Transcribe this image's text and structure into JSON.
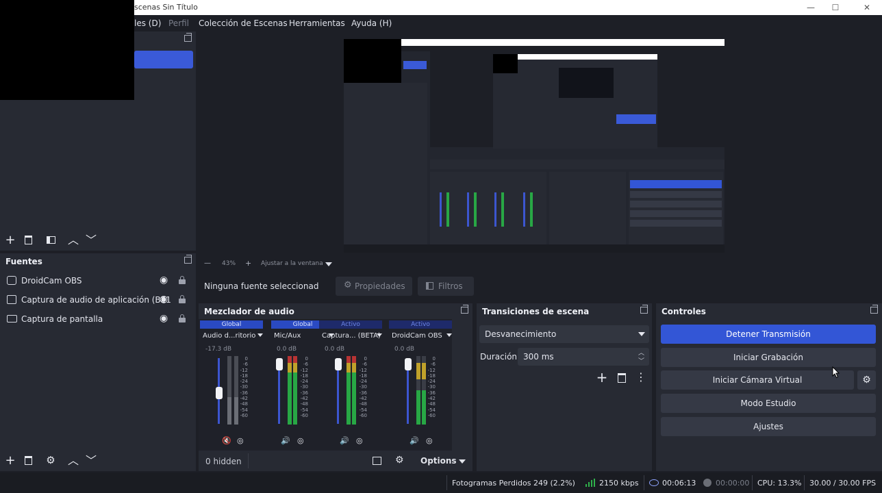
{
  "window": {
    "title": "scenas Sin Título",
    "controls": {
      "minimize": "—",
      "maximize": "☐",
      "close": "✕"
    }
  },
  "menu": {
    "items": [
      "les (D)",
      "Perfil",
      "Colección de Escenas",
      "Herramientas",
      "Ayuda (H)"
    ]
  },
  "scenes_dock": {
    "toolbar_icons": [
      "plus-icon",
      "trash-icon",
      "filter-icon",
      "arrow-up-icon",
      "arrow-down-icon"
    ]
  },
  "sources_dock": {
    "title": "Fuentes",
    "items": [
      {
        "name": "DroidCam OBS",
        "icon": "camera-icon"
      },
      {
        "name": "Captura de audio de aplicación (BE1",
        "icon": "app-audio-icon"
      },
      {
        "name": "Captura de pantalla",
        "icon": "monitor-icon"
      }
    ]
  },
  "preview_bar": {
    "minus": "—",
    "zoom": "43%",
    "plus": "+",
    "fit": "Ajustar a la ventana"
  },
  "context_bar": {
    "no_source": "Ninguna fuente seleccionad",
    "properties": "Propiedades",
    "filters": "Filtros"
  },
  "mixer": {
    "title": "Mezclador de audio",
    "channels": [
      {
        "head": "Global",
        "name": "Audio d...ritorio",
        "db": "-17.3 dB",
        "level": 0.45,
        "muted": true
      },
      {
        "head": "Global",
        "name": "Mic/Aux",
        "db": "0.0 dB",
        "level": 0.85,
        "muted": false
      },
      {
        "head": "Activo",
        "name": "Captura... (BETA)",
        "db": "0.0 dB",
        "level": 0.85,
        "muted": false
      },
      {
        "head": "Activo",
        "name": "DroidCam OBS",
        "db": "0.0 dB",
        "level": 0.85,
        "muted": false
      }
    ],
    "scale": [
      "0",
      "-6",
      "-12",
      "-18",
      "-24",
      "-30",
      "-36",
      "-42",
      "-48",
      "-54",
      "-60"
    ],
    "hidden": "0 hidden",
    "options": "Options"
  },
  "transitions": {
    "title": "Transiciones de escena",
    "selected": "Desvanecimiento",
    "duration_label": "Duración",
    "duration_value": "300 ms"
  },
  "controls": {
    "title": "Controles",
    "stop_stream": "Detener Transmisión",
    "start_recording": "Iniciar Grabación",
    "virtual_cam": "Iniciar Cámara Virtual",
    "studio_mode": "Modo Estudio",
    "settings": "Ajustes"
  },
  "status": {
    "dropped": "Fotogramas Perdidos 249 (2.2%)",
    "bitrate": "2150 kbps",
    "stream_time": "00:06:13",
    "rec_time": "00:00:00",
    "cpu": "CPU: 13.3%",
    "fps": "30.00 / 30.00 FPS"
  }
}
